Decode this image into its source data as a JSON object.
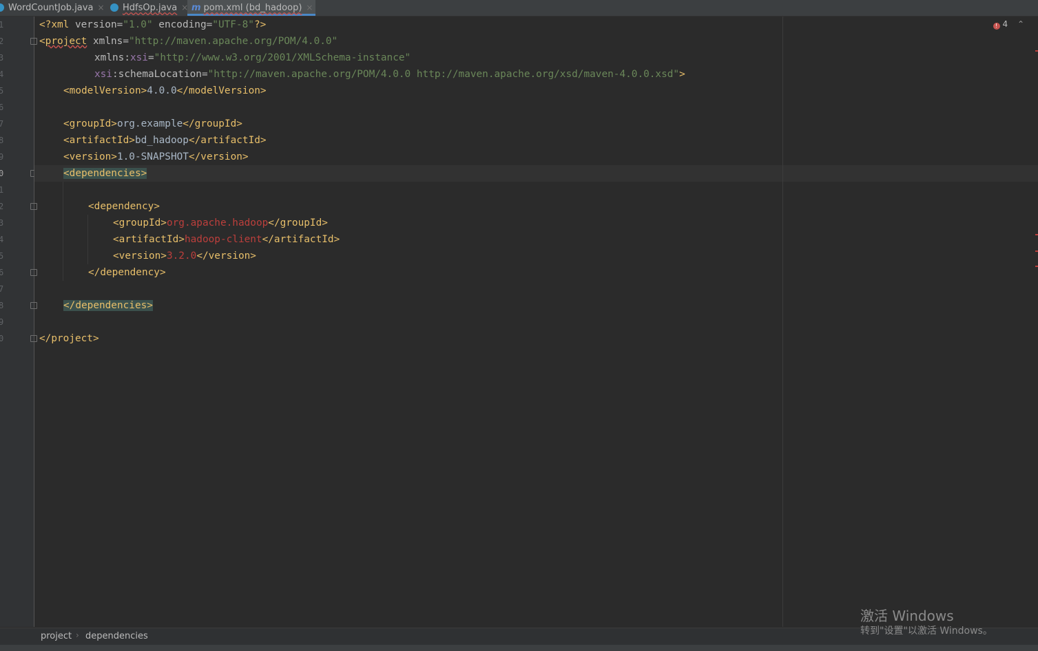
{
  "tabs": [
    {
      "label": "WordCountJob.java",
      "close": "×",
      "icon": "java-class-icon"
    },
    {
      "label": "HdfsOp.java",
      "close": "×",
      "icon": "java-class-icon"
    },
    {
      "label": "pom.xml (bd_hadoop)",
      "close": "×",
      "icon": "maven-icon",
      "icon_glyph": "m",
      "active": true
    }
  ],
  "inspections": {
    "errors": "4"
  },
  "line_numbers": [
    "1",
    "2",
    "3",
    "4",
    "5",
    "6",
    "7",
    "8",
    "9",
    "0",
    "1",
    "2",
    "3",
    "4",
    "5",
    "6",
    "7",
    "8",
    "9",
    "0"
  ],
  "code": {
    "l1": {
      "a": "<?xml ",
      "b": "version",
      "c": "=",
      "d": "\"1.0\"",
      "e": " encoding",
      "f": "=",
      "g": "\"UTF-8\"",
      "h": "?>"
    },
    "l2": {
      "a": "<",
      "b": "project",
      "c": " xmlns",
      "d": "=",
      "e": "\"http://maven.apache.org/POM/4.0.0\""
    },
    "l3": {
      "a": "xmlns:",
      "b": "xsi",
      "c": "=",
      "d": "\"http://www.w3.org/2001/XMLSchema-instance\""
    },
    "l4": {
      "a": "xsi",
      "b": ":schemaLocation",
      "c": "=",
      "d": "\"http://maven.apache.org/POM/4.0.0 http://maven.apache.org/xsd/maven-4.0.0.xsd\"",
      "e": ">"
    },
    "l5": {
      "a": "<modelVersion>",
      "b": "4.0.0",
      "c": "</modelVersion>"
    },
    "l7": {
      "a": "<groupId>",
      "b": "org.example",
      "c": "</groupId>"
    },
    "l8": {
      "a": "<artifactId>",
      "b": "bd_hadoop",
      "c": "</artifactId>"
    },
    "l9": {
      "a": "<version>",
      "b": "1.0-SNAPSHOT",
      "c": "</version>"
    },
    "l10": {
      "a": "<dependencies>"
    },
    "l12": {
      "a": "<dependency>"
    },
    "l13": {
      "a": "<groupId>",
      "b": "org.apache.hadoop",
      "c": "</groupId>"
    },
    "l14": {
      "a": "<artifactId>",
      "b": "hadoop-client",
      "c": "</artifactId>"
    },
    "l15": {
      "a": "<version>",
      "b": "3.2.0",
      "c": "</version>"
    },
    "l16": {
      "a": "</dependency>"
    },
    "l18": {
      "a": "</dependencies>"
    },
    "l20": {
      "a": "</",
      "b": "project",
      "c": ">"
    }
  },
  "breadcrumbs": [
    "project",
    "dependencies"
  ],
  "breadcrumb_sep": "›",
  "watermark": {
    "title": "激活 Windows",
    "subtitle": "转到\"设置\"以激活 Windows。"
  },
  "colors": {
    "tag": "#e8bf6a",
    "value": "#6a8759",
    "error": "#bc3f3c",
    "namespace": "#9876aa",
    "background": "#2b2b2b"
  }
}
